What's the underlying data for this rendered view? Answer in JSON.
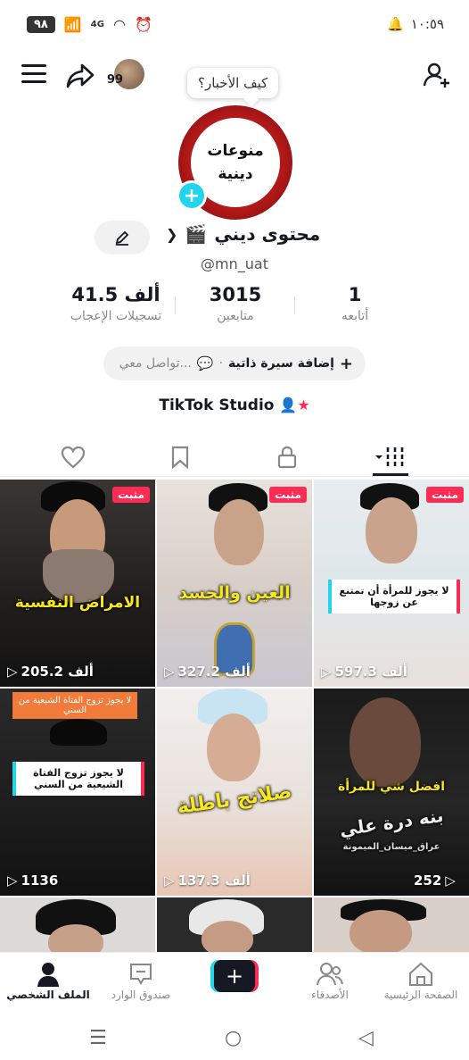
{
  "status_bar": {
    "battery": "٩٨",
    "network": "4G",
    "time": "١٠:٥٩"
  },
  "header": {
    "avatar_badge": "99",
    "greeting_bubble": "كيف الأخبار؟"
  },
  "profile": {
    "avatar_text_line1": "منوعات",
    "avatar_text_line2": "دينية",
    "display_name": "محتوى ديني",
    "username": "@mn_uat"
  },
  "stats": [
    {
      "value": "41.5 ألف",
      "label": "تسجيلات الإعجاب"
    },
    {
      "value": "3015",
      "label": "متابعين"
    },
    {
      "value": "1",
      "label": "أتابعه"
    }
  ],
  "bio": {
    "add_bio": "إضافة سيرة ذاتية",
    "separator": "·",
    "contact": "تواصل معي..."
  },
  "studio": {
    "label": "TikTok Studio"
  },
  "videos": [
    {
      "pinned": "مثبت",
      "views": "205.2 ألف",
      "caption": "الامراض النفسية"
    },
    {
      "pinned": "مثبت",
      "views": "327.2 ألف",
      "caption": "العين والحسد"
    },
    {
      "pinned": "مثبت",
      "views": "597.3 ألف",
      "box": "لا يجوز للمرأة أن تمتنع عن زوجها"
    },
    {
      "views": "1136",
      "orange": "لا يجوز تزوج الفتاة الشيعية من السني",
      "box": "لا يجوز تزوج الفتاة الشيعية من السني"
    },
    {
      "views": "137.3 ألف",
      "caption": "صلاتج باطلة"
    },
    {
      "views": "252",
      "caption": "افضل شي للمرأة",
      "caption2": "بنه درة علي",
      "caption3": "عراق_ميسان_الميمونة"
    }
  ],
  "bottom_nav": {
    "home": "الصفحة الرئيسية",
    "friends": "الأصدقاء",
    "create": "+",
    "inbox": "صندوق الوارد",
    "profile": "الملف الشخصي"
  }
}
